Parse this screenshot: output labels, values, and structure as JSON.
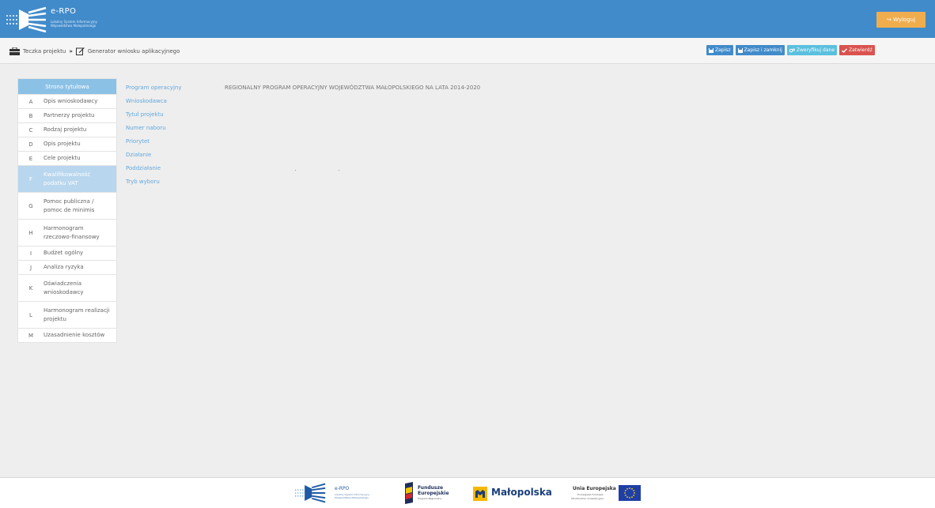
{
  "header": {
    "logo_title": "e-RPO",
    "logo_subtitle_1": "Lokalny System Informacyjny",
    "logo_subtitle_2": "Województwa Małopolskiego",
    "logout_label": "Wyloguj",
    "bg_color": "#428bca",
    "logout_color": "#f0ad4e"
  },
  "breadcrumb": {
    "item1": "Teczka projektu",
    "item2": "Generator wniosku aplikacyjnego",
    "item1_icon": "briefcase-icon",
    "item2_icon": "edit-icon"
  },
  "toolbar": {
    "save_label": "Zapisz",
    "save_close_label": "Zapisz i zamknij",
    "verify_label": "Zweryfikuj dane",
    "confirm_label": "Zatwierdź"
  },
  "sidebar": {
    "title": "Strona tytułowa",
    "items": [
      {
        "letter": "A",
        "label": "Opis wnioskodawcy"
      },
      {
        "letter": "B",
        "label": "Partnerzy projektu"
      },
      {
        "letter": "C",
        "label": "Rodzaj projektu"
      },
      {
        "letter": "D",
        "label": "Opis projektu"
      },
      {
        "letter": "E",
        "label": "Cele projektu"
      },
      {
        "letter": "F",
        "label": "Kwalifikowalność podatku VAT"
      },
      {
        "letter": "G",
        "label": "Pomoc publiczna / pomoc de minimis"
      },
      {
        "letter": "H",
        "label": "Harmonogram rzeczowo-finansowy"
      },
      {
        "letter": "I",
        "label": "Budżet ogólny"
      },
      {
        "letter": "J",
        "label": "Analiza ryzyka"
      },
      {
        "letter": "K",
        "label": "Oświadczenia wnioskodawcy"
      },
      {
        "letter": "L",
        "label": "Harmonogram realizacji projektu"
      },
      {
        "letter": "M",
        "label": "Uzasadnienie kosztów"
      }
    ]
  },
  "form": {
    "labels": {
      "program": "Program operacyjny",
      "applicant": "Wnioskodawca",
      "project_title": "Tytuł projektu",
      "call_number": "Numer naboru",
      "priority": "Priorytet",
      "action": "Działanie",
      "subaction": "Poddziałanie",
      "selection_mode": "Tryb wyboru"
    },
    "program_value": "REGIONALNY PROGRAM OPERACYJNY WOJEWÓDZTWA MAŁOPOLSKIEGO NA LATA 2014-2020"
  },
  "footer": {
    "erpo_title": "e-RPO",
    "erpo_sub1": "Lokalny System Informacyjny",
    "erpo_sub2": "Województwa Małopolskiego",
    "fe_title1": "Fundusze",
    "fe_title2": "Europejskie",
    "fe_sub": "Program Regionalny",
    "mp_title": "Małopolska",
    "ue_title": "Unia Europejska",
    "ue_sub1": "Europejskie Fundusze",
    "ue_sub2": "Strukturalne i Inwestycyjne"
  }
}
